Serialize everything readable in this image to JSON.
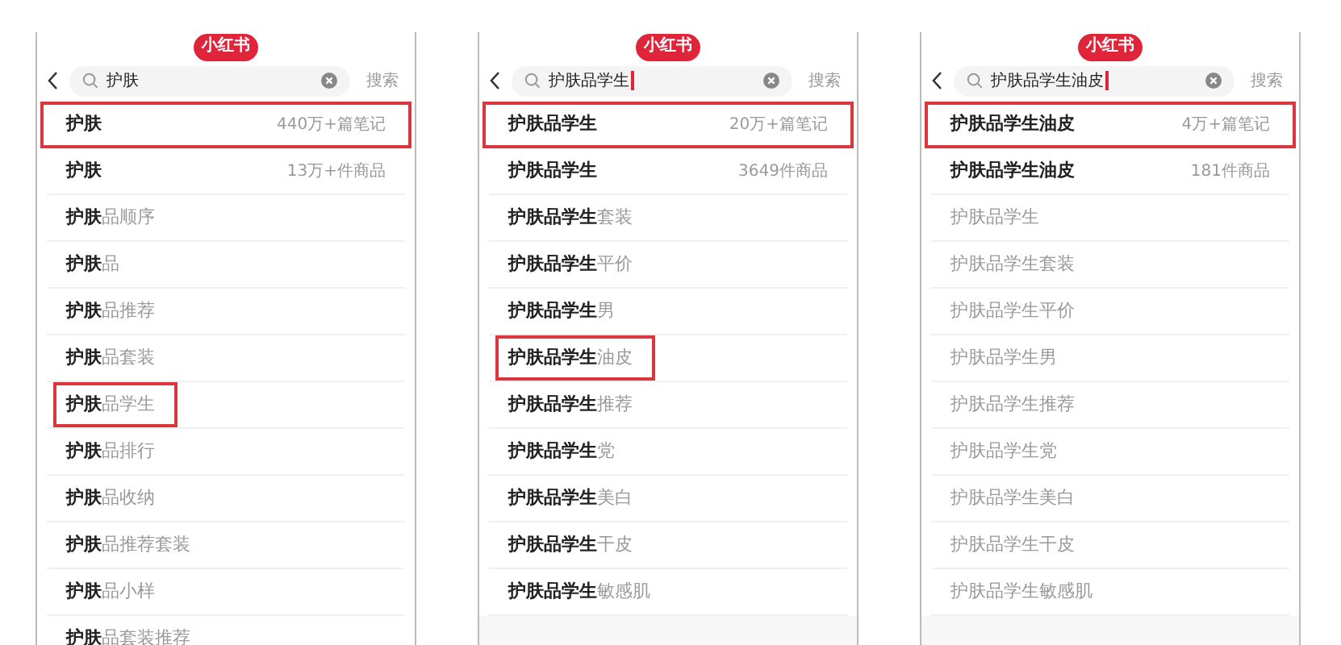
{
  "panels": [
    {
      "logo": "小红书",
      "search": {
        "value": "护肤",
        "cursor": false
      },
      "search_button": "搜索",
      "rows": [
        {
          "kind": "exact",
          "text": "护肤",
          "count": "440万+篇笔记",
          "highlighted": true
        },
        {
          "kind": "exact",
          "text": "护肤",
          "count": "13万+件商品",
          "highlighted": false
        },
        {
          "kind": "suggestion",
          "text": "**护肤**品顺序",
          "highlighted": false
        },
        {
          "kind": "suggestion",
          "text": "**护肤**品",
          "highlighted": false
        },
        {
          "kind": "suggestion",
          "text": "**护肤**品推荐",
          "highlighted": false
        },
        {
          "kind": "suggestion",
          "text": "**护肤**品套装",
          "highlighted": false
        },
        {
          "kind": "suggestion",
          "text": "**护肤**品学生",
          "highlighted": true
        },
        {
          "kind": "suggestion",
          "text": "**护肤**品排行",
          "highlighted": false
        },
        {
          "kind": "suggestion",
          "text": "**护肤**品收纳",
          "highlighted": false
        },
        {
          "kind": "suggestion",
          "text": "**护肤**品推荐套装",
          "highlighted": false
        },
        {
          "kind": "suggestion",
          "text": "**护肤**品小样",
          "highlighted": false
        },
        {
          "kind": "suggestion",
          "text": "**护肤**品套装推荐",
          "highlighted": false
        }
      ]
    },
    {
      "logo": "小红书",
      "search": {
        "value": "护肤品学生",
        "cursor": true
      },
      "search_button": "搜索",
      "rows": [
        {
          "kind": "exact",
          "text": "护肤品学生",
          "count": "20万+篇笔记",
          "highlighted": true
        },
        {
          "kind": "exact",
          "text": "护肤品学生",
          "count": "3649件商品",
          "highlighted": false
        },
        {
          "kind": "suggestion",
          "text": "**护肤品学生**套装",
          "highlighted": false
        },
        {
          "kind": "suggestion",
          "text": "**护肤品学生**平价",
          "highlighted": false
        },
        {
          "kind": "suggestion",
          "text": "**护肤品学生**男",
          "highlighted": false
        },
        {
          "kind": "suggestion",
          "text": "**护肤品学生**油皮",
          "highlighted": true
        },
        {
          "kind": "suggestion",
          "text": "**护肤品学生**推荐",
          "highlighted": false
        },
        {
          "kind": "suggestion",
          "text": "**护肤品学生**党",
          "highlighted": false
        },
        {
          "kind": "suggestion",
          "text": "**护肤品学生**美白",
          "highlighted": false
        },
        {
          "kind": "suggestion",
          "text": "**护肤品学生**干皮",
          "highlighted": false
        },
        {
          "kind": "suggestion",
          "text": "**护肤品学生**敏感肌",
          "highlighted": false
        }
      ]
    },
    {
      "logo": "小红书",
      "search": {
        "value": "护肤品学生油皮",
        "cursor": true
      },
      "search_button": "搜索",
      "rows": [
        {
          "kind": "exact",
          "text": "护肤品学生油皮",
          "count": "4万+篇笔记",
          "highlighted": true
        },
        {
          "kind": "exact",
          "text": "护肤品学生油皮",
          "count": "181件商品",
          "highlighted": false
        },
        {
          "kind": "suggestion",
          "text": "护肤品学生",
          "highlighted": false
        },
        {
          "kind": "suggestion",
          "text": "护肤品学生套装",
          "highlighted": false
        },
        {
          "kind": "suggestion",
          "text": "护肤品学生平价",
          "highlighted": false
        },
        {
          "kind": "suggestion",
          "text": "护肤品学生男",
          "highlighted": false
        },
        {
          "kind": "suggestion",
          "text": "护肤品学生推荐",
          "highlighted": false
        },
        {
          "kind": "suggestion",
          "text": "护肤品学生党",
          "highlighted": false
        },
        {
          "kind": "suggestion",
          "text": "护肤品学生美白",
          "highlighted": false
        },
        {
          "kind": "suggestion",
          "text": "护肤品学生干皮",
          "highlighted": false
        },
        {
          "kind": "suggestion",
          "text": "护肤品学生敏感肌",
          "highlighted": false
        }
      ]
    }
  ]
}
